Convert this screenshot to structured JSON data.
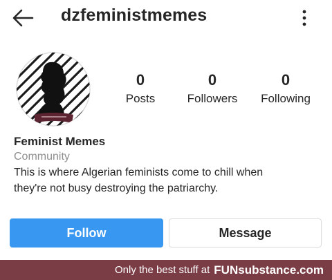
{
  "header": {
    "username": "dzfeministmemes",
    "back_icon": "arrow-left-icon",
    "more_icon": "more-vertical-icon"
  },
  "profile": {
    "avatar_icon": "silhouette-avatar-icon",
    "stats": {
      "posts_count": "0",
      "posts_label": "Posts",
      "followers_count": "0",
      "followers_label": "Followers",
      "following_count": "0",
      "following_label": "Following"
    },
    "bio": {
      "name": "Feminist Memes",
      "category": "Community",
      "line1": "This is where Algerian feminists come to chill when",
      "line2": "they're not busy destroying the patriarchy."
    }
  },
  "actions": {
    "follow_label": "Follow",
    "message_label": "Message"
  },
  "watermark": {
    "prefix": "Only the best stuff at",
    "brand": "FUNsubstance.com"
  },
  "colors": {
    "follow_bg": "#3897f0",
    "watermark_bg": "#7b3d45",
    "muted_text": "#8e8e8e"
  }
}
